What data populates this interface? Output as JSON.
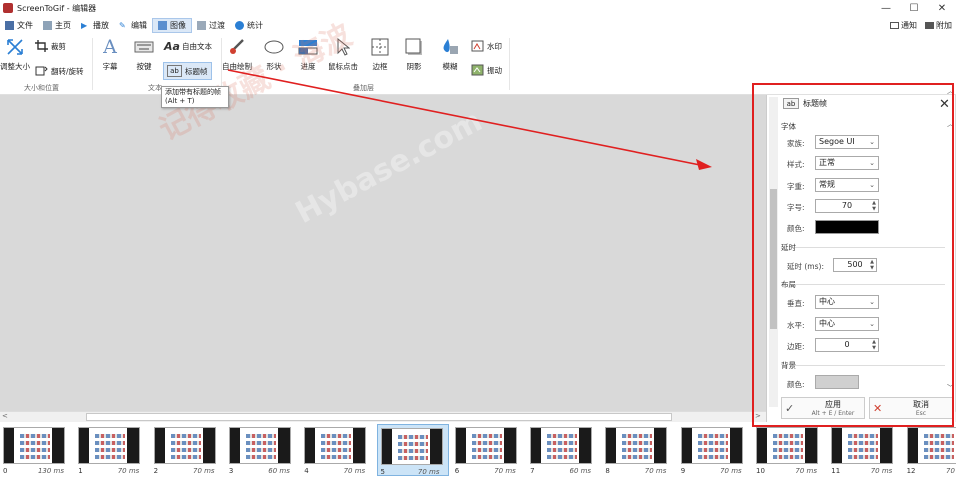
{
  "window": {
    "title": "ScreenToGif - 编辑器",
    "min": "—",
    "max": "☐",
    "close": "✕"
  },
  "tabs": [
    {
      "label": "文件"
    },
    {
      "label": "主页"
    },
    {
      "label": "播放"
    },
    {
      "label": "编辑"
    },
    {
      "label": "图像"
    },
    {
      "label": "过渡"
    },
    {
      "label": "统计"
    }
  ],
  "tabs_right": {
    "notify": "通知",
    "attach": "附加"
  },
  "ribbon": {
    "resize": "调整大小",
    "crop": "裁剪",
    "flip_rotate": "翻转/旋转",
    "group_size": "大小和位置",
    "caption": "字幕",
    "key": "按键",
    "free_text": "自由文本",
    "title_frame": "标题帧",
    "group_text": "文本",
    "free_draw": "自由绘制",
    "shape": "形状",
    "progress": "进度",
    "mouse_click": "鼠标点击",
    "border": "边框",
    "shadow": "阴影",
    "blur": "模糊",
    "watermark": "水印",
    "shake": "振动",
    "group_overlay": "叠加层"
  },
  "tooltip": {
    "line1": "添加带有标题的帧",
    "line2": "(Alt + T)"
  },
  "watermark_text": {
    "a": "记得收藏 · 海波",
    "b": "Hybase.com"
  },
  "panel": {
    "title": "标题帧",
    "font_section": "字体",
    "family_label": "家族:",
    "family_value": "Segoe UI",
    "style_label": "样式:",
    "style_value": "正常",
    "weight_label": "字重:",
    "weight_value": "常规",
    "size_label": "字号:",
    "size_value": "70",
    "color_label": "颜色:",
    "font_color": "#000000",
    "delay_section": "延时",
    "delay_label": "延时 (ms):",
    "delay_value": "500",
    "layout_section": "布局",
    "vertical_label": "垂直:",
    "vertical_value": "中心",
    "horizontal_label": "水平:",
    "horizontal_value": "中心",
    "margin_label": "边距:",
    "margin_value": "0",
    "bg_section": "背景",
    "bg_color_label": "颜色:",
    "bg_color": "#d0d0d0",
    "apply_label": "应用",
    "apply_hint": "Alt + E / Enter",
    "cancel_label": "取消",
    "cancel_hint": "Esc"
  },
  "frames": [
    {
      "num": "0",
      "ms": "130 ms"
    },
    {
      "num": "1",
      "ms": "70 ms"
    },
    {
      "num": "2",
      "ms": "70 ms"
    },
    {
      "num": "3",
      "ms": "60 ms"
    },
    {
      "num": "4",
      "ms": "70 ms"
    },
    {
      "num": "5",
      "ms": "70 ms"
    },
    {
      "num": "6",
      "ms": "70 ms"
    },
    {
      "num": "7",
      "ms": "60 ms"
    },
    {
      "num": "8",
      "ms": "70 ms"
    },
    {
      "num": "9",
      "ms": "70 ms"
    },
    {
      "num": "10",
      "ms": "70 ms"
    },
    {
      "num": "11",
      "ms": "70 ms"
    },
    {
      "num": "12",
      "ms": "70 ms"
    }
  ],
  "colors": {
    "accent": "#2b7fd4",
    "annotation": "#e02020",
    "selected_frame": "#cce4f7"
  }
}
